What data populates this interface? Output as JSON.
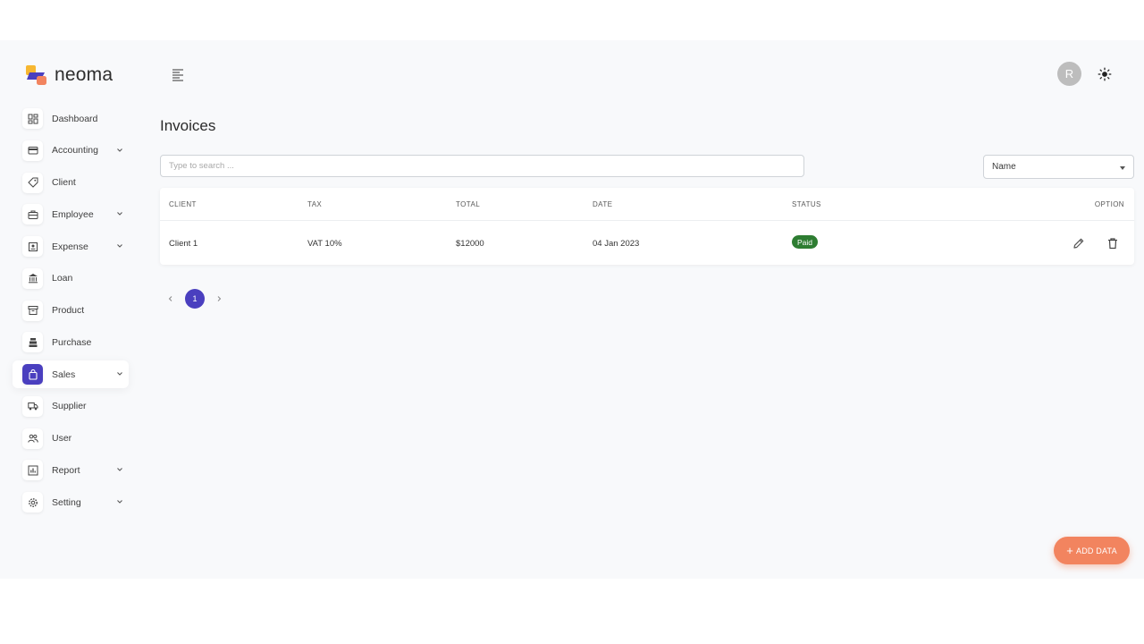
{
  "brand": {
    "name": "neoma"
  },
  "header": {
    "avatar_initial": "R"
  },
  "sidebar": {
    "items": [
      {
        "label": "Dashboard",
        "icon": "dashboard-icon",
        "has_submenu": false,
        "active": false
      },
      {
        "label": "Accounting",
        "icon": "wallet-icon",
        "has_submenu": true,
        "active": false
      },
      {
        "label": "Client",
        "icon": "tag-icon",
        "has_submenu": false,
        "active": false
      },
      {
        "label": "Employee",
        "icon": "briefcase-icon",
        "has_submenu": true,
        "active": false
      },
      {
        "label": "Expense",
        "icon": "receipt-icon",
        "has_submenu": true,
        "active": false
      },
      {
        "label": "Loan",
        "icon": "bank-icon",
        "has_submenu": false,
        "active": false
      },
      {
        "label": "Product",
        "icon": "archive-icon",
        "has_submenu": false,
        "active": false
      },
      {
        "label": "Purchase",
        "icon": "cart-icon",
        "has_submenu": false,
        "active": false
      },
      {
        "label": "Sales",
        "icon": "shopping-bag-icon",
        "has_submenu": true,
        "active": true
      },
      {
        "label": "Supplier",
        "icon": "truck-icon",
        "has_submenu": false,
        "active": false
      },
      {
        "label": "User",
        "icon": "users-icon",
        "has_submenu": false,
        "active": false
      },
      {
        "label": "Report",
        "icon": "chart-icon",
        "has_submenu": true,
        "active": false
      },
      {
        "label": "Setting",
        "icon": "gear-icon",
        "has_submenu": true,
        "active": false
      }
    ]
  },
  "main": {
    "title": "Invoices",
    "search": {
      "placeholder": "Type to search ...",
      "value": ""
    },
    "sort": {
      "selected": "Name"
    },
    "table": {
      "columns": [
        "CLIENT",
        "TAX",
        "TOTAL",
        "DATE",
        "STATUS",
        "OPTION"
      ],
      "rows": [
        {
          "client": "Client 1",
          "tax": "VAT 10%",
          "total": "$12000",
          "date": "04 Jan 2023",
          "status": "Paid"
        }
      ]
    },
    "pagination": {
      "current": "1"
    },
    "fab_label": "ADD DATA"
  },
  "colors": {
    "primary": "#4a3fbf",
    "accent": "#f2845f",
    "paid": "#2e7d32",
    "background": "#f8f9fb"
  }
}
